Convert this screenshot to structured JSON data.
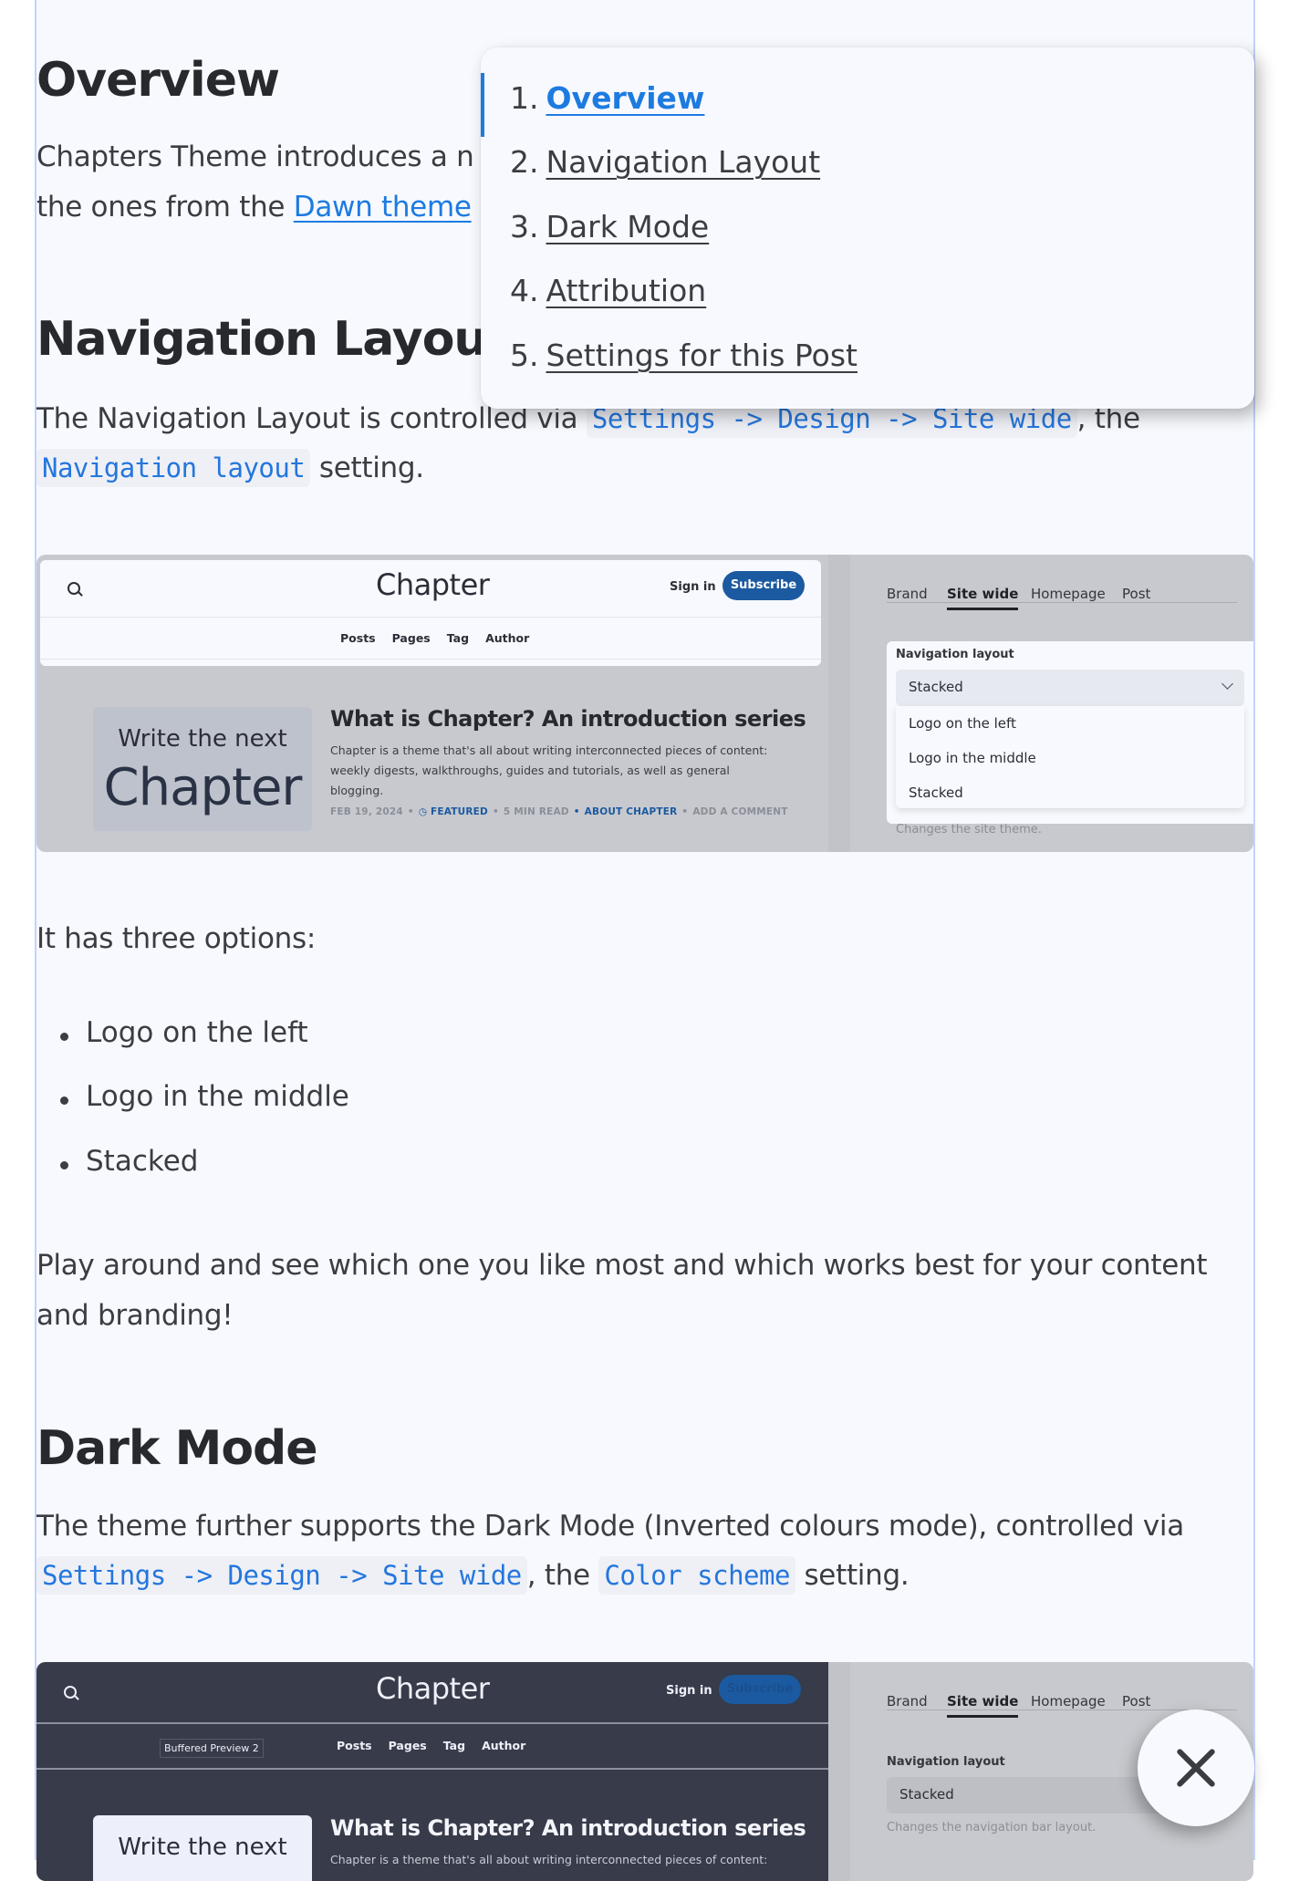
{
  "article": {
    "overview": {
      "heading": "Overview",
      "line1": "Chapters Theme introduces a n",
      "line2_prefix": "the ones from the ",
      "link": "Dawn theme"
    },
    "navigation_layout": {
      "heading": "Navigation Layout",
      "text1": "The Navigation Layout is controlled via ",
      "code1": "Settings -> Design -> Site wide",
      "text2": ", the",
      "code2": "Navigation layout",
      "text3": " setting.",
      "intro": "It has three options:",
      "options": [
        "Logo on the left",
        "Logo in the middle",
        "Stacked"
      ],
      "outro_line1": "Play around and see which one you like most and which works best for your content",
      "outro_line2": "and branding!"
    },
    "dark_mode": {
      "heading": "Dark Mode",
      "text1": "The theme further supports the Dark Mode (Inverted colours mode), controlled via",
      "code1": "Settings -> Design -> Site wide",
      "text2": ", the ",
      "code2": "Color scheme",
      "text3": " setting."
    }
  },
  "toc": {
    "items": [
      {
        "num": "1.",
        "label": "Overview",
        "active": true
      },
      {
        "num": "2.",
        "label": "Navigation Layout",
        "active": false
      },
      {
        "num": "3.",
        "label": "Dark Mode",
        "active": false
      },
      {
        "num": "4.",
        "label": "Attribution",
        "active": false
      },
      {
        "num": "5.",
        "label": "Settings for this Post",
        "active": false
      }
    ]
  },
  "preview_light": {
    "logo": "Chapter",
    "sign_in": "Sign in",
    "subscribe": "Subscribe",
    "nav": [
      "Posts",
      "Pages",
      "Tag",
      "Author"
    ],
    "feature_line1": "Write the next",
    "feature_line2": "Chapter",
    "post_title": "What is Chapter? An introduction series",
    "post_excerpt": "Chapter is a theme that's all about writing interconnected pieces of content: weekly digests, walkthroughs, guides and tutorials, as well as general blogging.",
    "meta": {
      "date": "FEB 19, 2024",
      "featured": "FEATURED",
      "read_time": "5 MIN READ",
      "tag": "ABOUT CHAPTER",
      "comment": "ADD A COMMENT"
    },
    "settings": {
      "tabs": [
        "Brand",
        "Site wide",
        "Homepage",
        "Post"
      ],
      "active_tab": "Site wide",
      "field_label": "Navigation layout",
      "selected": "Stacked",
      "dropdown_options": [
        "Logo on the left",
        "Logo in the middle",
        "Stacked"
      ],
      "hint": "Changes the site theme."
    }
  },
  "preview_dark": {
    "logo": "Chapter",
    "sign_in": "Sign in",
    "subscribe": "Subscribe",
    "tooltip": "Buffered Preview 2",
    "nav": [
      "Posts",
      "Pages",
      "Tag",
      "Author"
    ],
    "feature_line1": "Write the next",
    "post_title": "What is Chapter? An introduction series",
    "post_excerpt": "Chapter is a theme that's all about writing interconnected pieces of content:",
    "settings": {
      "tabs": [
        "Brand",
        "Site wide",
        "Homepage",
        "Post"
      ],
      "active_tab": "Site wide",
      "field_label": "Navigation layout",
      "selected": "Stacked",
      "hint": "Changes the navigation bar layout."
    }
  },
  "colors": {
    "accent": "#1d7be0",
    "page_bg": "#f7f9fe",
    "text": "#3b3d42",
    "subscribe_bg": "#1b5aa0",
    "dark_preview_bg": "#373b4a"
  },
  "close_button": {
    "icon": "close-icon"
  }
}
